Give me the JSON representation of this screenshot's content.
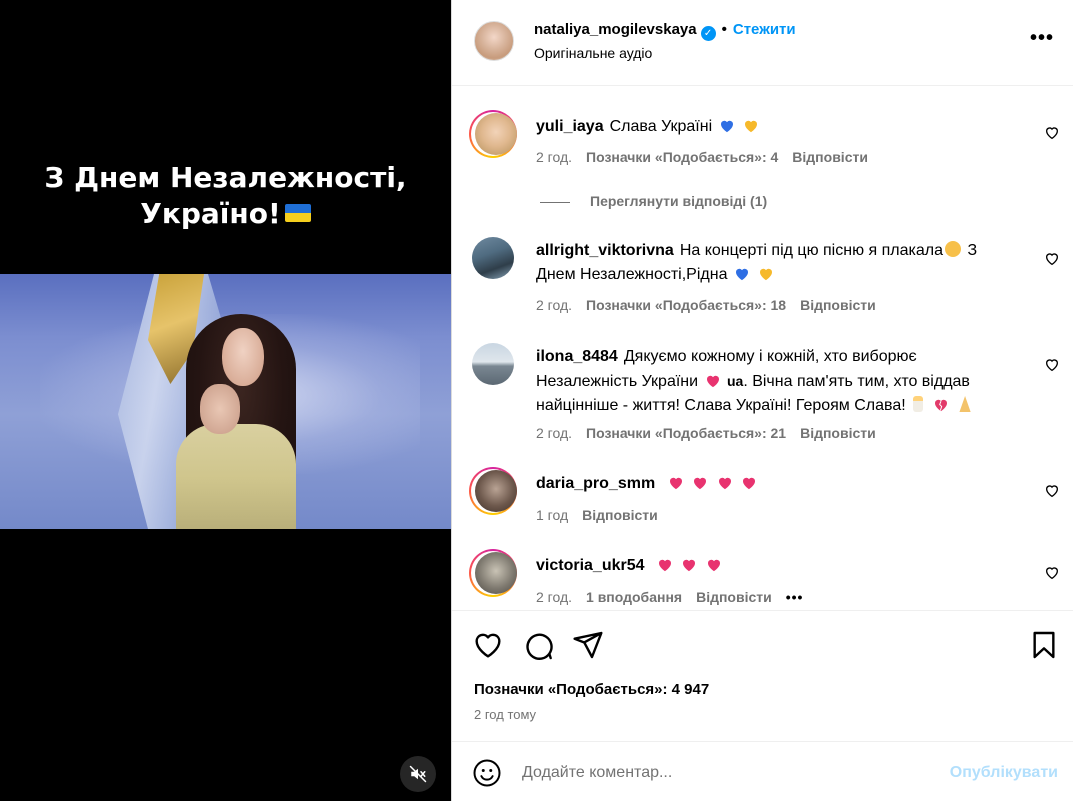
{
  "video": {
    "caption_line1": "З Днем Незалежності,",
    "caption_line2": "Україно!",
    "mute_icon": "volume-muted-icon"
  },
  "post": {
    "username": "nataliya_mogilevskaya",
    "verified": true,
    "separator": "•",
    "follow_label": "Стежити",
    "audio_label": "Оригінальне аудіо",
    "more_label": "•••"
  },
  "comments": [
    {
      "username": "yuli_iaya",
      "text": "Слава Україні",
      "emojis": [
        "blue-heart",
        "yellow-heart"
      ],
      "time": "2 год.",
      "likes": "Позначки «Подобається»: 4",
      "reply": "Відповісти",
      "view_replies": "Переглянути відповіді (1)",
      "has_story_ring": true
    },
    {
      "username": "allright_viktorivna",
      "text": "На концерті під цю пісню я плакала",
      "text2": " З Днем Незалежності,Рідна",
      "time": "2 год.",
      "likes": "Позначки «Подобається»: 18",
      "reply": "Відповісти",
      "has_story_ring": false
    },
    {
      "username": "ilona_8484",
      "text": "Дякуємо кожному і кожній, хто виборює Незалежність України",
      "text_badge": "ua",
      "text2": ". Вічна пам'ять тим, хто віддав найцінніше - життя! Слава Україні! Героям Слава!",
      "time": "2 год.",
      "likes": "Позначки «Подобається»: 21",
      "reply": "Відповісти",
      "has_story_ring": false
    },
    {
      "username": "daria_pro_smm",
      "text": "",
      "time": "1 год",
      "reply": "Відповісти",
      "has_story_ring": true
    },
    {
      "username": "victoria_ukr54",
      "text": "",
      "time": "2 год.",
      "likes": "1 вподобання",
      "reply": "Відповісти",
      "more": "•••",
      "has_story_ring": true
    }
  ],
  "actions": {
    "likes_text": "Позначки «Подобається»: 4 947",
    "time_ago": "2 год тому"
  },
  "composer": {
    "placeholder": "Додайте коментар...",
    "publish_label": "Опублікувати"
  },
  "colors": {
    "accent": "#0095f6",
    "muted": "#737373",
    "publish_disabled": "#b2dffc"
  }
}
